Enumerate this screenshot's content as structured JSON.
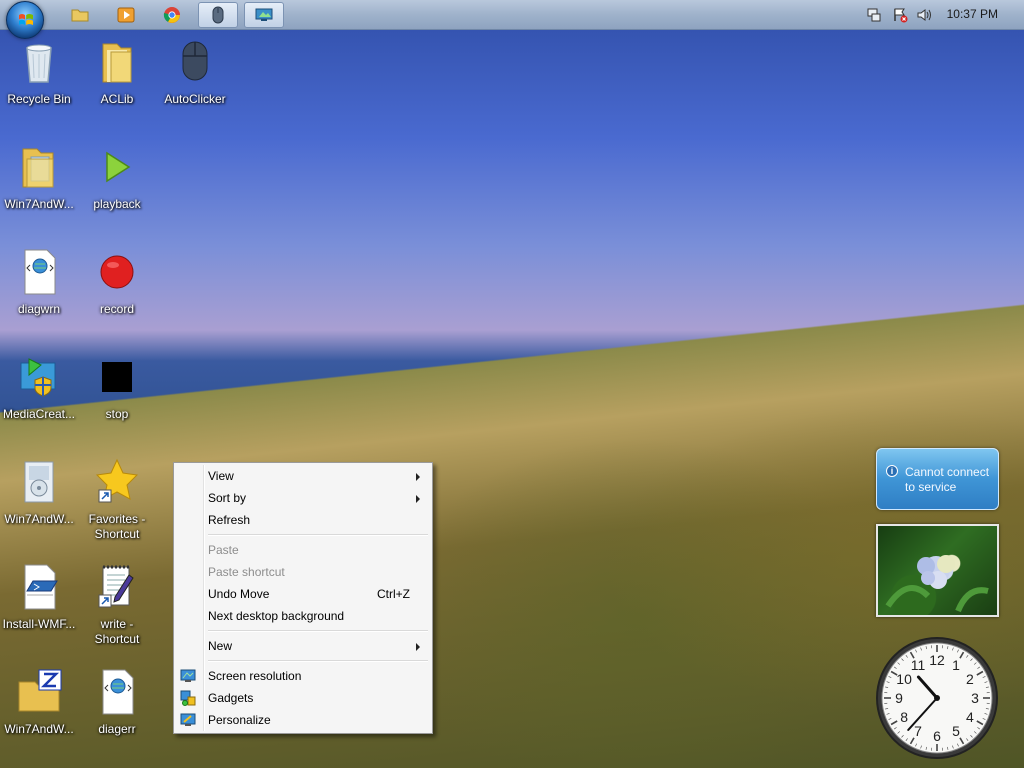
{
  "taskbar": {
    "clock": "10:37 PM",
    "pinned": [
      {
        "name": "folder-icon"
      },
      {
        "name": "media-player-icon"
      },
      {
        "name": "chrome-icon"
      },
      {
        "name": "mouse-icon"
      },
      {
        "name": "screen-icon"
      }
    ],
    "tray": [
      "network-icon",
      "action-center-icon",
      "volume-icon"
    ]
  },
  "desktop": {
    "icons": [
      {
        "label": "Recycle Bin",
        "icon": "recycle-bin-icon"
      },
      {
        "label": "ACLib",
        "icon": "folder-icon"
      },
      {
        "label": "AutoClicker",
        "icon": "mouse-icon"
      },
      {
        "label": "Win7AndW...",
        "icon": "folder-icon"
      },
      {
        "label": "playback",
        "icon": "play-icon"
      },
      {
        "label": "diagwrn",
        "icon": "script-file-icon"
      },
      {
        "label": "record",
        "icon": "record-icon"
      },
      {
        "label": "MediaCreat...",
        "icon": "installer-icon"
      },
      {
        "label": "stop",
        "icon": "stop-icon"
      },
      {
        "label": "Win7AndW...",
        "icon": "installer-icon"
      },
      {
        "label": "Favorites -\nShortcut",
        "icon": "star-icon"
      },
      {
        "label": "Install-WMF...",
        "icon": "powershell-file-icon"
      },
      {
        "label": "write -\nShortcut",
        "icon": "notepad-icon"
      },
      {
        "label": "Win7AndW...",
        "icon": "zip-folder-icon"
      },
      {
        "label": "diagerr",
        "icon": "script-file-icon"
      }
    ]
  },
  "context_menu": {
    "view": "View",
    "sort_by": "Sort by",
    "refresh": "Refresh",
    "paste": "Paste",
    "paste_shortcut": "Paste shortcut",
    "undo_move": "Undo Move",
    "undo_shortcut": "Ctrl+Z",
    "next_background": "Next desktop background",
    "new": "New",
    "screen_resolution": "Screen resolution",
    "gadgets": "Gadgets",
    "personalize": "Personalize"
  },
  "gadgets": {
    "weather_message": "Cannot connect\nto service",
    "clock_time": "10:37",
    "clock_numbers": [
      "12",
      "1",
      "2",
      "3",
      "4",
      "5",
      "6",
      "7",
      "8",
      "9",
      "10",
      "11"
    ]
  }
}
